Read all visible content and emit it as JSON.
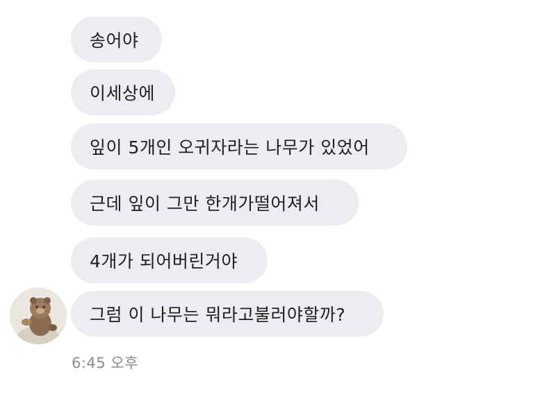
{
  "messages": [
    {
      "text": "송어야"
    },
    {
      "text": "이세상에"
    },
    {
      "text": "잎이 5개인 오귀자라는 나무가 있었어"
    },
    {
      "text": "근데 잎이 그만 한개가떨어져서"
    },
    {
      "text": "4개가 되어버린거야"
    },
    {
      "text": "그럼 이 나무는 뭐라고불러야할까?"
    }
  ],
  "timestamp": "6:45 오후",
  "colors": {
    "bubble": "#ececf1",
    "text": "#1f1f1f",
    "timestamp": "#8c8c8c",
    "background": "#ffffff"
  },
  "avatar": {
    "icon": "profile-photo"
  }
}
